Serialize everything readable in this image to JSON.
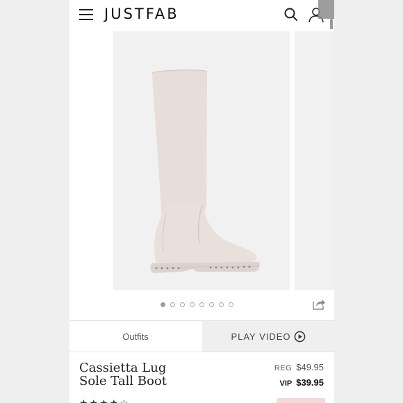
{
  "header": {
    "logo": "JUSTFAB",
    "menu_icon": "hamburger-menu-icon",
    "search_icon": "search-icon",
    "account_icon": "account-icon"
  },
  "gallery": {
    "image_count": 8,
    "active_index": 0,
    "share_icon": "share-icon"
  },
  "tabs": {
    "outfits_label": "Outfits",
    "video_label": "PLAY VIDEO",
    "video_icon": "play-circle-icon"
  },
  "product": {
    "name": "Cassietta Lug Sole Tall Boot",
    "reg_label": "REG",
    "reg_price": "$49.95",
    "vip_label": "VIP",
    "vip_price": "$39.95",
    "rating_stars": "★★★★☆"
  },
  "colors": {
    "boot": "#e7ddd9",
    "background": "#f1f1f1",
    "accent_pink": "#f4d9d6"
  }
}
